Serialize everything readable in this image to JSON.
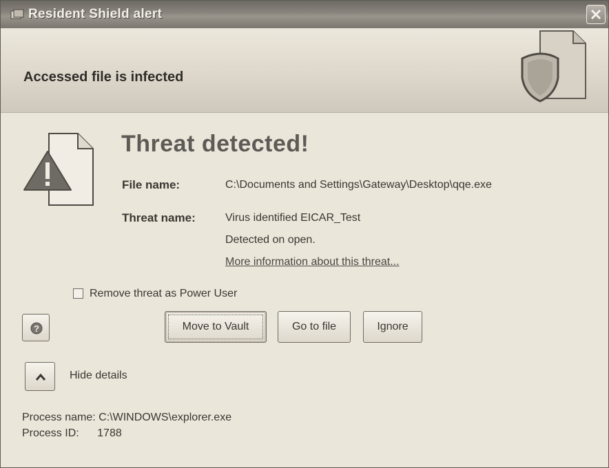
{
  "window": {
    "title": "Resident Shield alert"
  },
  "banner": {
    "headline": "Accessed file is infected",
    "icon": "shield-document-icon"
  },
  "threat": {
    "heading": "Threat detected!",
    "icon": "warning-document-icon",
    "file_name_label": "File name:",
    "file_name_value": "C:\\Documents and Settings\\Gateway\\Desktop\\qqe.exe",
    "threat_name_label": "Threat name:",
    "threat_name_value": "Virus identified EICAR_Test",
    "detected_text": "Detected on open.",
    "more_info_link": "More information about this threat..."
  },
  "options": {
    "remove_as_power_user_label": "Remove threat as Power User",
    "remove_as_power_user_checked": false
  },
  "buttons": {
    "help_icon": "help-icon",
    "move_to_vault": "Move to Vault",
    "go_to_file": "Go to file",
    "ignore": "Ignore"
  },
  "details_toggle": {
    "label": "Hide details",
    "icon": "chevron-up-icon"
  },
  "details": {
    "process_name_label": "Process name:",
    "process_name_value": "C:\\WINDOWS\\explorer.exe",
    "process_id_label": "Process ID:",
    "process_id_value": "1788"
  }
}
